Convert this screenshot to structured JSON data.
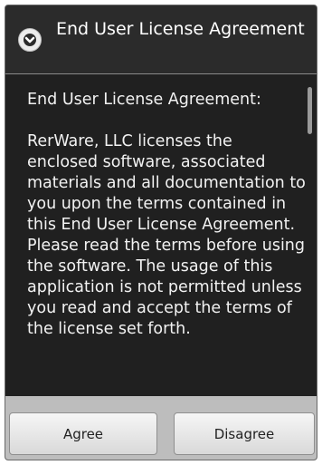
{
  "dialog": {
    "title": "End User License Agreement",
    "icon": "info-chevron-icon",
    "heading": "End User License Agreement:",
    "body": "RerWare, LLC licenses the enclosed software, associated materials and all documentation to you upon the terms contained in this End User License Agreement. Please read the terms before using the software. The usage of this application is not permitted unless you read and accept the terms of the license set forth."
  },
  "buttons": {
    "agree_label": "Agree",
    "disagree_label": "Disagree"
  },
  "colors": {
    "dialog_background": "#2b2b2b",
    "content_background": "#202020",
    "button_bar": "#bdbdbd",
    "text": "#f2f2f2"
  }
}
